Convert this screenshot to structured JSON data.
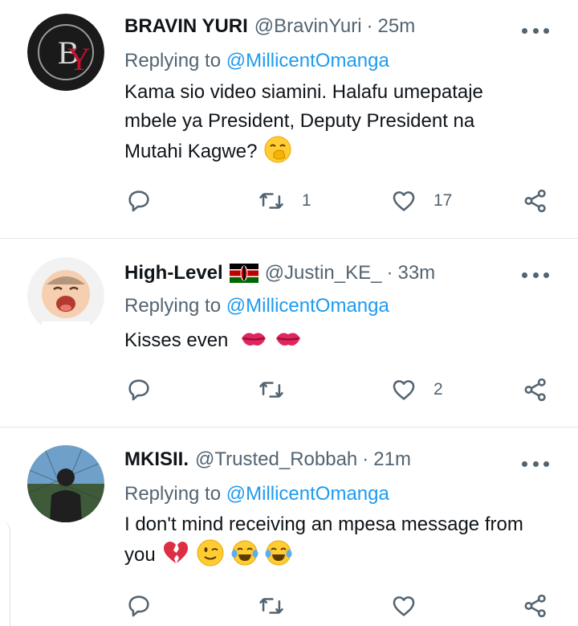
{
  "tweets": [
    {
      "name": "BRAVIN YURI",
      "handle": "@BravinYuri",
      "separator": "·",
      "time": "25m",
      "replying_prefix": "Replying to",
      "replying_to": "@MillicentOmanga",
      "text_lines": [
        "Kama sio video siamini. Halafu umepataje",
        "mbele ya President, Deputy President na",
        "Mutahi Kagwe?"
      ],
      "emojis": [
        "hand-over-mouth-emoji"
      ],
      "avatar_text": "BY",
      "retweets": "1",
      "likes": "17"
    },
    {
      "name": "High-Level",
      "handle": "@Justin_KE_",
      "separator": "·",
      "time": "33m",
      "flag": "kenya-flag-emoji",
      "replying_prefix": "Replying to",
      "replying_to": "@MillicentOmanga",
      "text_lines": [
        "Kisses even"
      ],
      "emojis": [
        "kiss-mark-emoji",
        "kiss-mark-emoji"
      ],
      "retweets": "",
      "likes": "2"
    },
    {
      "name": "MKISII.",
      "handle": "@Trusted_Robbah",
      "separator": "·",
      "time": "21m",
      "replying_prefix": "Replying to",
      "replying_to": "@MillicentOmanga",
      "text_lines": [
        "I don't mind receiving an mpesa message from",
        "you"
      ],
      "emojis": [
        "broken-heart-emoji",
        "winking-face-emoji",
        "tears-of-joy-emoji",
        "tears-of-joy-emoji"
      ],
      "retweets": "",
      "likes": ""
    }
  ],
  "colors": {
    "text": "#0f1419",
    "secondary": "#536471",
    "link": "#1d9bf0",
    "divider": "#e1e8ed"
  },
  "icons": [
    "reply-icon",
    "retweet-icon",
    "like-icon",
    "share-icon",
    "more-icon"
  ]
}
